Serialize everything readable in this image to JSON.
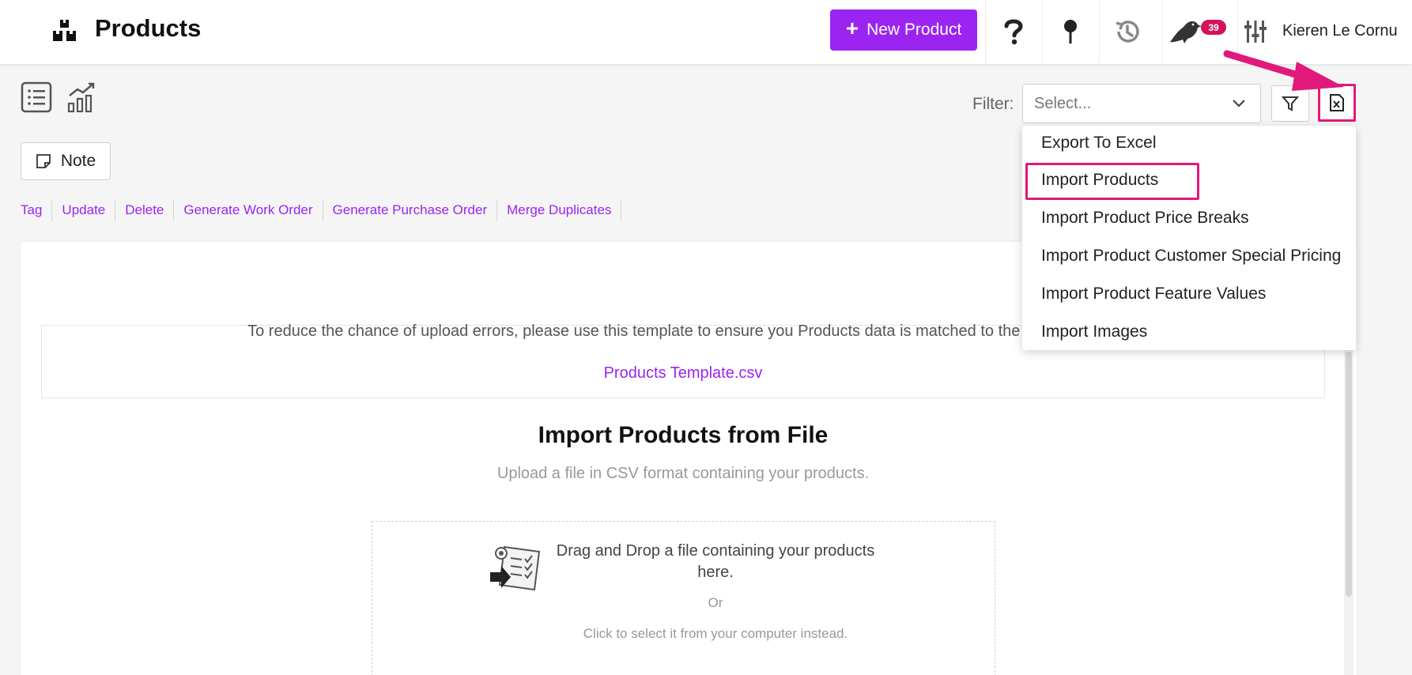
{
  "header": {
    "title": "Products",
    "new_product_label": "New Product",
    "notification_count": "39",
    "user_name": "Kieren Le Cornu"
  },
  "toolbar": {
    "filter_label": "Filter:",
    "filter_placeholder": "Select...",
    "note_label": "Note"
  },
  "actions": [
    "Tag",
    "Update",
    "Delete",
    "Generate Work Order",
    "Generate Purchase Order",
    "Merge Duplicates"
  ],
  "dropdown_menu": {
    "items": [
      "Export To Excel",
      "Import Products",
      "Import Product Price Breaks",
      "Import Product Customer Special Pricing",
      "Import Product Feature Values",
      "Import Images"
    ],
    "highlighted": "Import Products"
  },
  "template": {
    "instruction": "To reduce the chance of upload errors, please use this template to ensure you Products data is matched to the correct fields.",
    "link_text": "Products Template.csv"
  },
  "import": {
    "title": "Import Products from File",
    "subtitle": "Upload a file in CSV format containing your products.",
    "drop_text": "Drag and Drop a file containing your products here.",
    "or_text": "Or",
    "click_text": "Click to select it from your computer instead."
  },
  "colors": {
    "accent": "#9b24f0",
    "highlight": "#e0197a",
    "badge": "#d1155c"
  }
}
